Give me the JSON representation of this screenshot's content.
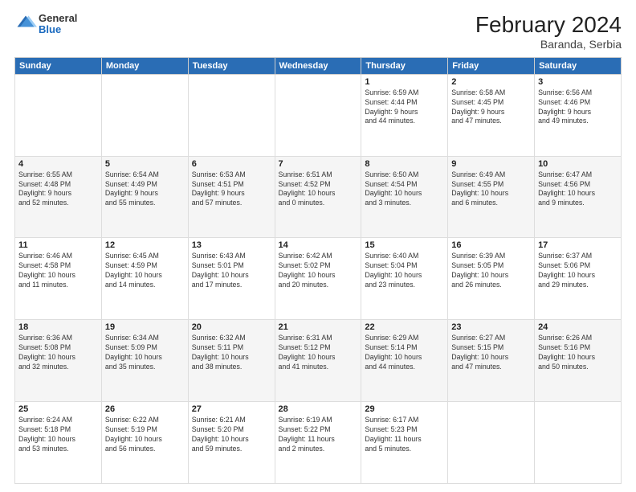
{
  "header": {
    "logo_general": "General",
    "logo_blue": "Blue",
    "month_year": "February 2024",
    "location": "Baranda, Serbia"
  },
  "weekdays": [
    "Sunday",
    "Monday",
    "Tuesday",
    "Wednesday",
    "Thursday",
    "Friday",
    "Saturday"
  ],
  "rows": [
    [
      {
        "day": "",
        "info": ""
      },
      {
        "day": "",
        "info": ""
      },
      {
        "day": "",
        "info": ""
      },
      {
        "day": "",
        "info": ""
      },
      {
        "day": "1",
        "info": "Sunrise: 6:59 AM\nSunset: 4:44 PM\nDaylight: 9 hours\nand 44 minutes."
      },
      {
        "day": "2",
        "info": "Sunrise: 6:58 AM\nSunset: 4:45 PM\nDaylight: 9 hours\nand 47 minutes."
      },
      {
        "day": "3",
        "info": "Sunrise: 6:56 AM\nSunset: 4:46 PM\nDaylight: 9 hours\nand 49 minutes."
      }
    ],
    [
      {
        "day": "4",
        "info": "Sunrise: 6:55 AM\nSunset: 4:48 PM\nDaylight: 9 hours\nand 52 minutes."
      },
      {
        "day": "5",
        "info": "Sunrise: 6:54 AM\nSunset: 4:49 PM\nDaylight: 9 hours\nand 55 minutes."
      },
      {
        "day": "6",
        "info": "Sunrise: 6:53 AM\nSunset: 4:51 PM\nDaylight: 9 hours\nand 57 minutes."
      },
      {
        "day": "7",
        "info": "Sunrise: 6:51 AM\nSunset: 4:52 PM\nDaylight: 10 hours\nand 0 minutes."
      },
      {
        "day": "8",
        "info": "Sunrise: 6:50 AM\nSunset: 4:54 PM\nDaylight: 10 hours\nand 3 minutes."
      },
      {
        "day": "9",
        "info": "Sunrise: 6:49 AM\nSunset: 4:55 PM\nDaylight: 10 hours\nand 6 minutes."
      },
      {
        "day": "10",
        "info": "Sunrise: 6:47 AM\nSunset: 4:56 PM\nDaylight: 10 hours\nand 9 minutes."
      }
    ],
    [
      {
        "day": "11",
        "info": "Sunrise: 6:46 AM\nSunset: 4:58 PM\nDaylight: 10 hours\nand 11 minutes."
      },
      {
        "day": "12",
        "info": "Sunrise: 6:45 AM\nSunset: 4:59 PM\nDaylight: 10 hours\nand 14 minutes."
      },
      {
        "day": "13",
        "info": "Sunrise: 6:43 AM\nSunset: 5:01 PM\nDaylight: 10 hours\nand 17 minutes."
      },
      {
        "day": "14",
        "info": "Sunrise: 6:42 AM\nSunset: 5:02 PM\nDaylight: 10 hours\nand 20 minutes."
      },
      {
        "day": "15",
        "info": "Sunrise: 6:40 AM\nSunset: 5:04 PM\nDaylight: 10 hours\nand 23 minutes."
      },
      {
        "day": "16",
        "info": "Sunrise: 6:39 AM\nSunset: 5:05 PM\nDaylight: 10 hours\nand 26 minutes."
      },
      {
        "day": "17",
        "info": "Sunrise: 6:37 AM\nSunset: 5:06 PM\nDaylight: 10 hours\nand 29 minutes."
      }
    ],
    [
      {
        "day": "18",
        "info": "Sunrise: 6:36 AM\nSunset: 5:08 PM\nDaylight: 10 hours\nand 32 minutes."
      },
      {
        "day": "19",
        "info": "Sunrise: 6:34 AM\nSunset: 5:09 PM\nDaylight: 10 hours\nand 35 minutes."
      },
      {
        "day": "20",
        "info": "Sunrise: 6:32 AM\nSunset: 5:11 PM\nDaylight: 10 hours\nand 38 minutes."
      },
      {
        "day": "21",
        "info": "Sunrise: 6:31 AM\nSunset: 5:12 PM\nDaylight: 10 hours\nand 41 minutes."
      },
      {
        "day": "22",
        "info": "Sunrise: 6:29 AM\nSunset: 5:14 PM\nDaylight: 10 hours\nand 44 minutes."
      },
      {
        "day": "23",
        "info": "Sunrise: 6:27 AM\nSunset: 5:15 PM\nDaylight: 10 hours\nand 47 minutes."
      },
      {
        "day": "24",
        "info": "Sunrise: 6:26 AM\nSunset: 5:16 PM\nDaylight: 10 hours\nand 50 minutes."
      }
    ],
    [
      {
        "day": "25",
        "info": "Sunrise: 6:24 AM\nSunset: 5:18 PM\nDaylight: 10 hours\nand 53 minutes."
      },
      {
        "day": "26",
        "info": "Sunrise: 6:22 AM\nSunset: 5:19 PM\nDaylight: 10 hours\nand 56 minutes."
      },
      {
        "day": "27",
        "info": "Sunrise: 6:21 AM\nSunset: 5:20 PM\nDaylight: 10 hours\nand 59 minutes."
      },
      {
        "day": "28",
        "info": "Sunrise: 6:19 AM\nSunset: 5:22 PM\nDaylight: 11 hours\nand 2 minutes."
      },
      {
        "day": "29",
        "info": "Sunrise: 6:17 AM\nSunset: 5:23 PM\nDaylight: 11 hours\nand 5 minutes."
      },
      {
        "day": "",
        "info": ""
      },
      {
        "day": "",
        "info": ""
      }
    ]
  ]
}
